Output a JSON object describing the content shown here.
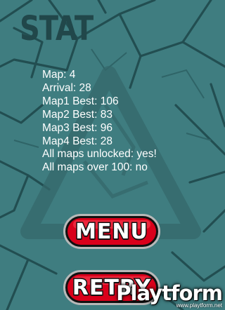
{
  "screen": {
    "title": "STAT",
    "stats": [
      "Map: 4",
      "Arrival: 28",
      "Map1 Best: 106",
      "Map2 Best: 83",
      "Map3 Best: 96",
      "Map4 Best: 28",
      "All maps unlocked: yes!",
      "All maps over 100: no"
    ]
  },
  "buttons": {
    "menu": "MENU",
    "retry": "RETRY"
  },
  "watermark": {
    "brand": "Playtform",
    "url": "www.playtform.net"
  },
  "colors": {
    "background": "#3f7d80",
    "lines": "#224e51",
    "title": "#21474a",
    "button_red": "#d9001b",
    "button_rim": "#b8b8b8",
    "text": "#ffffff"
  }
}
